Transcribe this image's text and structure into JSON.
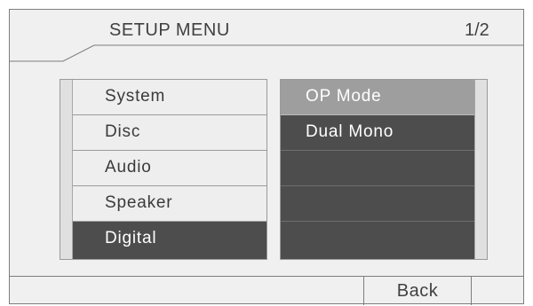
{
  "header": {
    "title": "SETUP MENU",
    "page_indicator": "1/2"
  },
  "left_menu": {
    "items": [
      {
        "label": "System"
      },
      {
        "label": "Disc"
      },
      {
        "label": "Audio"
      },
      {
        "label": "Speaker"
      },
      {
        "label": "Digital"
      }
    ],
    "selected_index": 4
  },
  "right_menu": {
    "items": [
      {
        "label": "OP Mode"
      },
      {
        "label": "Dual Mono"
      },
      {
        "label": ""
      },
      {
        "label": ""
      },
      {
        "label": ""
      }
    ],
    "highlighted_index": 0
  },
  "footer": {
    "back_label": "Back"
  },
  "colors": {
    "selected_bg": "#4d4d4d",
    "highlight_bg": "#9e9e9e",
    "panel_bg": "#eeeeee"
  }
}
